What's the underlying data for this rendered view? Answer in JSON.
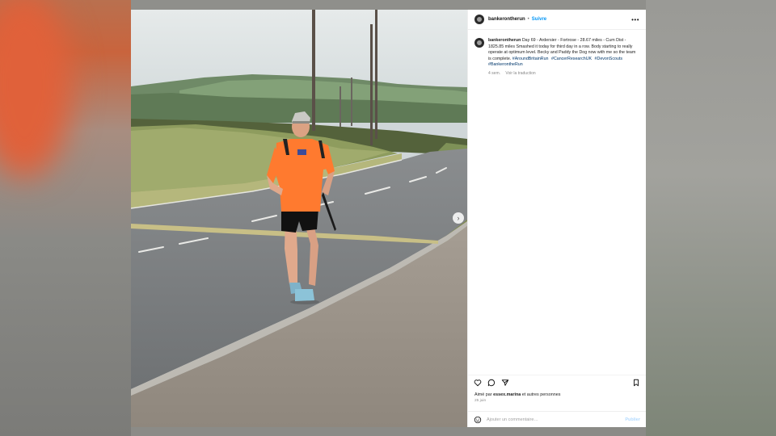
{
  "post": {
    "username": "bankerontherun",
    "separator": "•",
    "follow_label": "Suivre",
    "more_label": "•••",
    "caption_user": "bankerontherun",
    "caption_text": "Day 69 - Ardersier - Fortrose - 28.67 miles - Cum Dist - 1825.85 miles Smashed it today for third day in a row. Body starting to really operate at optimum level. Becky and Paddy the Dog now with me so the team is complete.",
    "hashtags": [
      "#AroundBritainRun",
      "#CancerResearchUK",
      "#DevonScouts",
      "#BankerontheRun"
    ],
    "time_ago": "4 sem.",
    "translate_label": "Voir la traduction",
    "likes_prefix": "Aimé par",
    "likes_user": "essex.marina",
    "likes_suffix": "et autres personnes",
    "date": "25 juin",
    "comment_placeholder": "Ajouter un commentaire…",
    "publish_label": "Publier",
    "next_label": "›"
  },
  "icons": {
    "like": "heart-icon",
    "comment": "comment-icon",
    "share": "send-icon",
    "save": "bookmark-icon",
    "emoji": "smile-icon",
    "next": "chevron-right-icon",
    "more": "more-icon"
  },
  "colors": {
    "accent": "#0095f6",
    "hashtag": "#00376b",
    "publish_disabled": "#b3dbff",
    "shirt": "#ff7a2f"
  }
}
